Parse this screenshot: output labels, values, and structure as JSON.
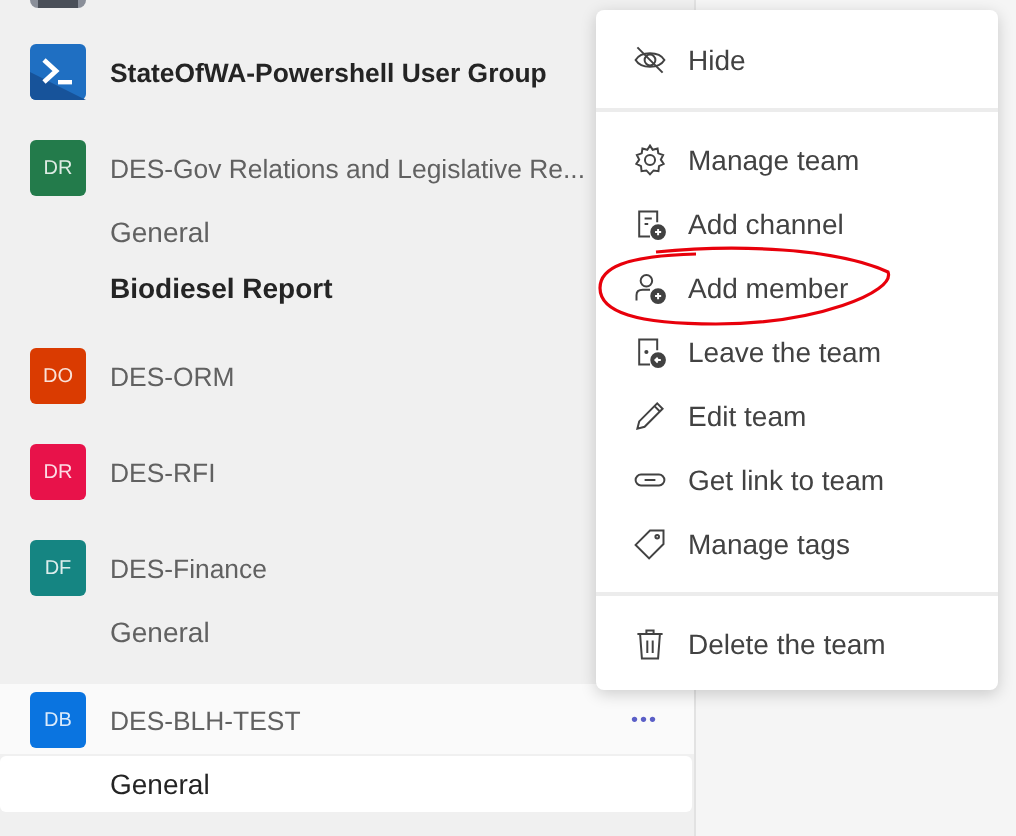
{
  "teams": [
    {
      "kind": "powershell",
      "name": "StateOfWA-Powershell User Group",
      "unread": true,
      "hovered": false
    },
    {
      "kind": "initials",
      "initials": "DR",
      "color": "#237b4b",
      "name": "DES-Gov Relations and Legislative Re...",
      "unread": false,
      "hovered": false,
      "channels": [
        {
          "name": "General",
          "unread": false,
          "selected": false
        },
        {
          "name": "Biodiesel Report",
          "unread": true,
          "selected": false
        }
      ]
    },
    {
      "kind": "initials",
      "initials": "DO",
      "color": "#da3b01",
      "name": "DES-ORM",
      "unread": false,
      "hovered": false
    },
    {
      "kind": "initials",
      "initials": "DR",
      "color": "#e8124a",
      "name": "DES-RFI",
      "unread": false,
      "hovered": false
    },
    {
      "kind": "initials",
      "initials": "DF",
      "color": "#158582",
      "name": "DES-Finance",
      "unread": false,
      "hovered": false,
      "channels": [
        {
          "name": "General",
          "unread": false,
          "selected": false
        }
      ]
    },
    {
      "kind": "initials",
      "initials": "DB",
      "color": "#0a74e0",
      "name": "DES-BLH-TEST",
      "unread": false,
      "hovered": true,
      "more": "•••",
      "channels": [
        {
          "name": "General",
          "unread": false,
          "selected": true
        }
      ]
    }
  ],
  "menu": {
    "groups": [
      [
        {
          "kind": "hide",
          "label": "Hide",
          "circled": false
        }
      ],
      [
        {
          "kind": "gear",
          "label": "Manage team",
          "circled": false
        },
        {
          "kind": "add-channel",
          "label": "Add channel",
          "circled": false
        },
        {
          "kind": "add-member",
          "label": "Add member",
          "circled": true
        },
        {
          "kind": "leave",
          "label": "Leave the team",
          "circled": false
        },
        {
          "kind": "pencil",
          "label": "Edit team",
          "circled": false
        },
        {
          "kind": "link",
          "label": "Get link to team",
          "circled": false
        },
        {
          "kind": "tag",
          "label": "Manage tags",
          "circled": false
        }
      ],
      [
        {
          "kind": "trash",
          "label": "Delete the team",
          "circled": false
        }
      ]
    ]
  }
}
